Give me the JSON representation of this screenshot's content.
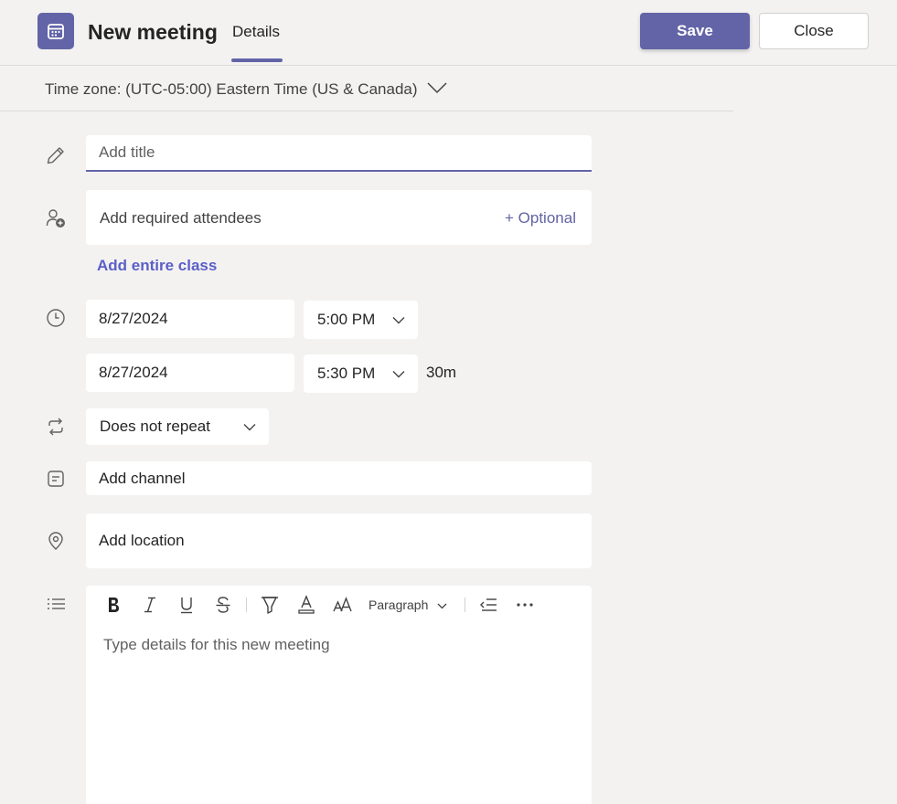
{
  "header": {
    "title": "New meeting",
    "tab": "Details",
    "save_label": "Save",
    "close_label": "Close",
    "accent": "#6264a7"
  },
  "timezone": {
    "label": "Time zone: (UTC-05:00) Eastern Time (US & Canada)"
  },
  "form": {
    "title_placeholder": "Add title",
    "attendees_placeholder": "Add required attendees",
    "optional_label": "+ Optional",
    "entire_class_label": "Add entire class",
    "start_date": "8/27/2024",
    "start_time": "5:00 PM",
    "end_date": "8/27/2024",
    "end_time": "5:30 PM",
    "duration": "30m",
    "repeat": "Does not repeat",
    "channel_placeholder": "Add channel",
    "location_placeholder": "Add location"
  },
  "editor": {
    "paragraph_label": "Paragraph",
    "placeholder": "Type details for this new meeting",
    "tools": [
      "bold-icon",
      "italic-icon",
      "underline-icon",
      "strikethrough-icon",
      "highlight-icon",
      "font-color-icon",
      "font-size-icon",
      "paragraph-dropdown",
      "decrease-indent-icon",
      "more-icon"
    ]
  }
}
